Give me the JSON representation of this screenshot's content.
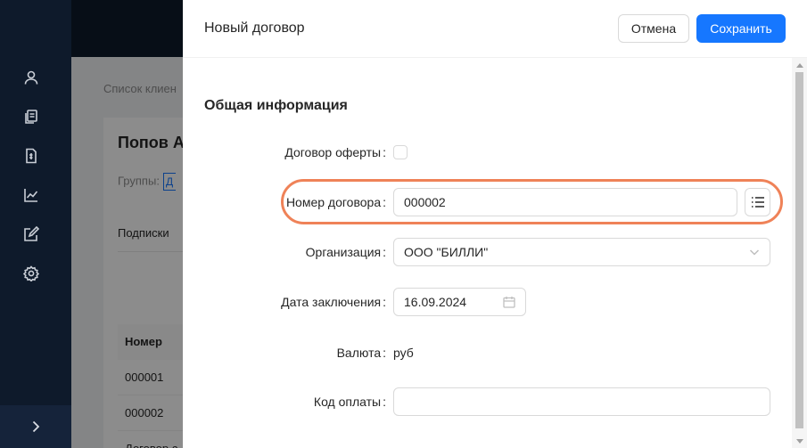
{
  "nav": {
    "icons": [
      "user-icon",
      "documents-icon",
      "invoice-icon",
      "chart-icon",
      "edit-icon",
      "settings-icon"
    ],
    "expand_icon": "chevron-right-icon"
  },
  "background_page": {
    "breadcrumb": "Список клиен",
    "client_name": "Попов А",
    "groups_label": "Группы:",
    "group_tag": "Д",
    "subscriptions_tab": "Подписки",
    "table": {
      "header": "Номер",
      "rows": [
        "000001",
        "000002",
        "Договор с"
      ]
    }
  },
  "drawer": {
    "title": "Новый договор",
    "cancel_label": "Отмена",
    "save_label": "Сохранить",
    "section_title": "Общая информация",
    "fields": {
      "offer_label": "Договор оферты",
      "offer_checked": false,
      "number_label": "Номер договора",
      "number_value": "000002",
      "organization_label": "Организация",
      "organization_value": "ООО \"БИЛЛИ\"",
      "date_label": "Дата заключения",
      "date_value": "16.09.2024",
      "currency_label": "Валюта",
      "currency_value": "руб",
      "paycode_label": "Код оплаты",
      "paycode_value": ""
    }
  },
  "colors": {
    "primary": "#1677ff",
    "highlight": "#ef8258",
    "nav_bg": "#0e1a2b"
  }
}
